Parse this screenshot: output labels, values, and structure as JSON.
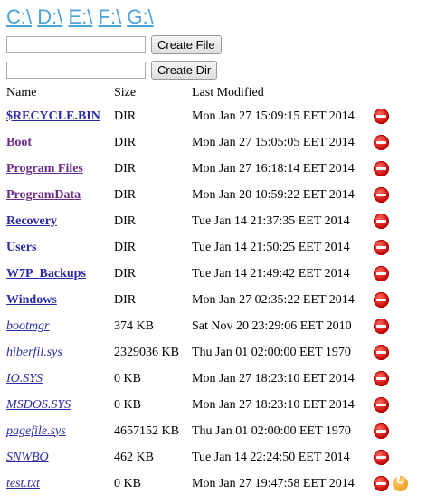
{
  "drives": [
    "C:\\",
    "D:\\",
    "E:\\",
    "F:\\",
    "G:\\"
  ],
  "actions": {
    "create_file_label": "Create File",
    "create_dir_label": "Create Dir",
    "file_input_value": "",
    "dir_input_value": ""
  },
  "headers": {
    "name": "Name",
    "size": "Size",
    "modified": "Last Modified"
  },
  "entries": [
    {
      "name": "$RECYCLE.BIN",
      "size": "DIR",
      "modified": "Mon Jan 27 15:09:15 EET 2014",
      "type": "dir"
    },
    {
      "name": "Boot",
      "size": "DIR",
      "modified": "Mon Jan 27 15:05:05 EET 2014",
      "type": "dir",
      "visited": true
    },
    {
      "name": "Program Files",
      "size": "DIR",
      "modified": "Mon Jan 27 16:18:14 EET 2014",
      "type": "dir",
      "visited": true
    },
    {
      "name": "ProgramData",
      "size": "DIR",
      "modified": "Mon Jan 20 10:59:22 EET 2014",
      "type": "dir",
      "visited": true
    },
    {
      "name": "Recovery",
      "size": "DIR",
      "modified": "Tue Jan 14 21:37:35 EET 2014",
      "type": "dir"
    },
    {
      "name": "Users",
      "size": "DIR",
      "modified": "Tue Jan 14 21:50:25 EET 2014",
      "type": "dir"
    },
    {
      "name": "W7P_Backups",
      "size": "DIR",
      "modified": "Tue Jan 14 21:49:42 EET 2014",
      "type": "dir"
    },
    {
      "name": "Windows",
      "size": "DIR",
      "modified": "Mon Jan 27 02:35:22 EET 2014",
      "type": "dir"
    },
    {
      "name": "bootmgr",
      "size": "374 KB",
      "modified": "Sat Nov 20 23:29:06 EET 2010",
      "type": "file"
    },
    {
      "name": "hiberfil.sys",
      "size": "2329036 KB",
      "modified": "Thu Jan 01 02:00:00 EET 1970",
      "type": "file"
    },
    {
      "name": "IO.SYS",
      "size": "0 KB",
      "modified": "Mon Jan 27 18:23:10 EET 2014",
      "type": "file"
    },
    {
      "name": "MSDOS.SYS",
      "size": "0 KB",
      "modified": "Mon Jan 27 18:23:10 EET 2014",
      "type": "file"
    },
    {
      "name": "pagefile.sys",
      "size": "4657152 KB",
      "modified": "Thu Jan 01 02:00:00 EET 1970",
      "type": "file"
    },
    {
      "name": "SNWBO",
      "size": "462 KB",
      "modified": "Tue Jan 14 22:24:50 EET 2014",
      "type": "file"
    },
    {
      "name": "test.txt",
      "size": "0 KB",
      "modified": "Mon Jan 27 19:47:58 EET 2014",
      "type": "file",
      "reload": true
    }
  ],
  "icons": {
    "delete": "delete-icon",
    "reload": "reload-icon"
  }
}
